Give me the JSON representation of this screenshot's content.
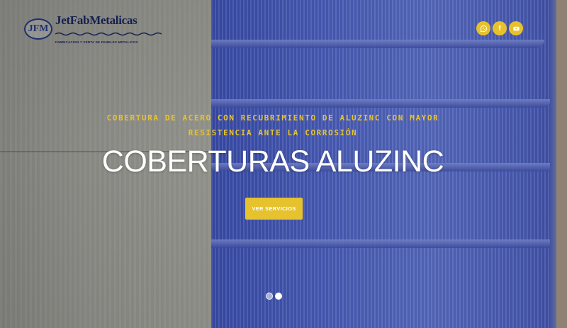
{
  "brand": {
    "badge": "JFM",
    "name": "JetFabMetalicas",
    "tagline": "FABRICACION Y VENTA DE PANELES METALICOS"
  },
  "social": [
    {
      "icon": "whatsapp-icon"
    },
    {
      "icon": "facebook-icon",
      "glyph": "f"
    },
    {
      "icon": "youtube-icon"
    }
  ],
  "hero": {
    "subtitle_line1": "COBERTURA DE ACERO CON RECUBRIMIENTO DE ALUZINC CON MAYOR",
    "subtitle_line2": "RESISTENCIA ANTE LA CORROSIÓN",
    "title": "COBERTURAS ALUZINC",
    "cta_label": "VER SERVICIOS"
  },
  "slider": {
    "slides": 2,
    "active": 2
  },
  "colors": {
    "accent": "#e5c22e",
    "logo": "#14204e",
    "title": "#ffffff"
  }
}
